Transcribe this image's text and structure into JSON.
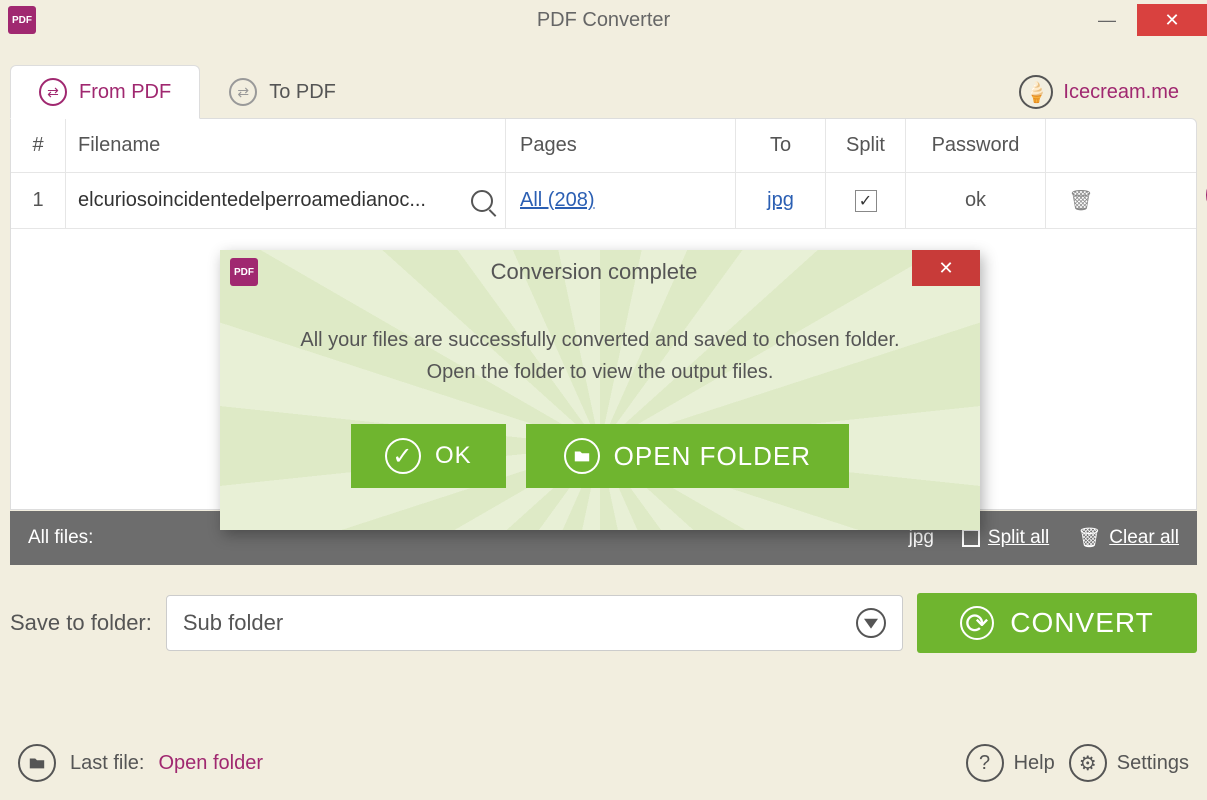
{
  "window": {
    "title": "PDF Converter"
  },
  "tabs": {
    "from_pdf": "From PDF",
    "to_pdf": "To PDF"
  },
  "brand": {
    "text": "Icecream.me"
  },
  "table": {
    "headers": {
      "idx": "#",
      "filename": "Filename",
      "pages": "Pages",
      "to": "To",
      "split": "Split",
      "password": "Password"
    },
    "rows": [
      {
        "idx": "1",
        "filename": "elcuriosoincidentedelperroamedianoc...",
        "pages": "All (208)",
        "to": "jpg",
        "split_checked": true,
        "password": "ok"
      }
    ]
  },
  "allfiles": {
    "label": "All files:",
    "jpg": "jpg",
    "split_all": "Split all",
    "clear_all": "Clear all"
  },
  "save": {
    "label": "Save to folder:",
    "value": "Sub folder"
  },
  "convert": {
    "label": "CONVERT"
  },
  "bottom": {
    "last_file_label": "Last file:",
    "open_folder": "Open folder",
    "help": "Help",
    "settings": "Settings"
  },
  "modal": {
    "title": "Conversion complete",
    "line1": "All your files are successfully converted and saved to chosen folder.",
    "line2": "Open the folder to view the output files.",
    "ok": "OK",
    "open_folder": "OPEN FOLDER"
  }
}
